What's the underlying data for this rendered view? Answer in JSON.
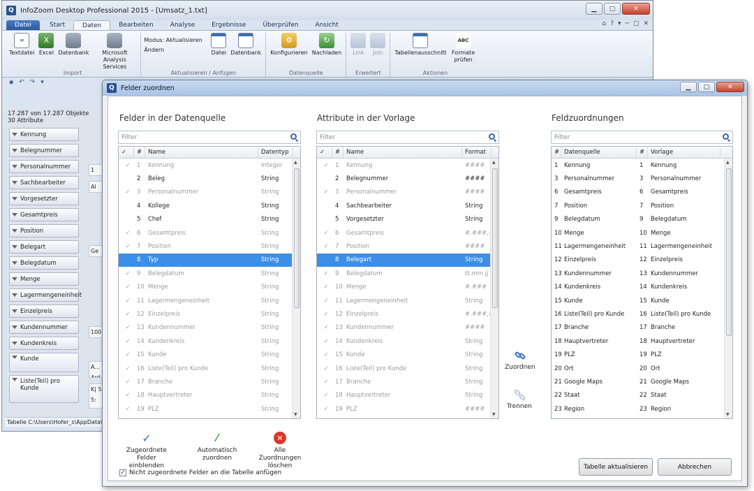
{
  "app": {
    "title": "InfoZoom Desktop Professional 2015 - [Umsatz_1.txt]",
    "win_min": "▁",
    "win_max": "▢",
    "win_close": "✕"
  },
  "ribbon": {
    "tabs": [
      "Datei",
      "Start",
      "Daten",
      "Bearbeiten",
      "Analyse",
      "Ergebnisse",
      "Überprüfen",
      "Ansicht"
    ],
    "right_icons": [
      "⌂",
      "?",
      "▾",
      "─",
      "▢",
      "✕"
    ],
    "groups": {
      "import": {
        "label": "Import",
        "buttons": [
          "Textdatei",
          "Excel",
          "Datenbank",
          "Microsoft Analysis Services"
        ]
      },
      "update": {
        "label": "Aktualisieren / Anfügen",
        "mode": "Modus: Aktualisieren",
        "change": "Ändern",
        "buttons": [
          "Datei",
          "Datenbank"
        ]
      },
      "source": {
        "label": "Datenquelle",
        "buttons": [
          "Konfigurieren",
          "Nachladen"
        ]
      },
      "extended": {
        "label": "Erweitert",
        "buttons": [
          "Link",
          "Join"
        ]
      },
      "actions": {
        "label": "Aktionen",
        "buttons": [
          "Tabellenausschnitt",
          "Formate prüfen"
        ]
      }
    }
  },
  "left": {
    "objects": "17.287 von 17.287 Objekte",
    "attributes": "30 Attribute",
    "attr_buttons": [
      "Kennung",
      "Belegnummer",
      "Personalnummer",
      "Sachbearbeiter",
      "Vorgesetzter",
      "Gesamtpreis",
      "Position",
      "Belegart",
      "Belegdatum",
      "Menge",
      "Lagermengeneinheit",
      "Einzelpreis",
      "Kundennummer",
      "Kundenkreis",
      "Kunde",
      "Liste(Teil) pro Kunde"
    ],
    "values": [
      "1",
      "Al",
      "Ge",
      "100",
      "A... Ard",
      "K| 5: 5:"
    ],
    "status": "Tabelle  C:\\Users\\Hofer_s\\AppData\\L"
  },
  "dialog": {
    "title": "Felder zuordnen",
    "source": {
      "title": "Felder in der Datenquelle",
      "filter_placeholder": "Filter",
      "headers": [
        "#",
        "Name",
        "Datentyp"
      ],
      "rows": [
        {
          "n": "1",
          "name": "Kennung",
          "type": "Integer",
          "mapped": true
        },
        {
          "n": "2",
          "name": "Beleg",
          "type": "String",
          "mapped": false
        },
        {
          "n": "3",
          "name": "Personalnummer",
          "type": "String",
          "mapped": true
        },
        {
          "n": "4",
          "name": "Kollege",
          "type": "String",
          "mapped": false
        },
        {
          "n": "5",
          "name": "Chef",
          "type": "String",
          "mapped": false
        },
        {
          "n": "6",
          "name": "Gesamtpreis",
          "type": "String",
          "mapped": true
        },
        {
          "n": "7",
          "name": "Position",
          "type": "String",
          "mapped": true
        },
        {
          "n": "8",
          "name": "Typ",
          "type": "String",
          "mapped": false,
          "selected": true
        },
        {
          "n": "9",
          "name": "Belegdatum",
          "type": "String",
          "mapped": true
        },
        {
          "n": "10",
          "name": "Menge",
          "type": "String",
          "mapped": true
        },
        {
          "n": "11",
          "name": "Lagermengeneinheit",
          "type": "String",
          "mapped": true
        },
        {
          "n": "12",
          "name": "Einzelpreis",
          "type": "String",
          "mapped": true
        },
        {
          "n": "13",
          "name": "Kundennummer",
          "type": "String",
          "mapped": true
        },
        {
          "n": "14",
          "name": "Kundenkreis",
          "type": "String",
          "mapped": true
        },
        {
          "n": "15",
          "name": "Kunde",
          "type": "String",
          "mapped": true
        },
        {
          "n": "16",
          "name": "Liste(Teil) pro Kunde",
          "type": "String",
          "mapped": true
        },
        {
          "n": "17",
          "name": "Branche",
          "type": "String",
          "mapped": true
        },
        {
          "n": "18",
          "name": "Hauptvertreter",
          "type": "String",
          "mapped": true
        },
        {
          "n": "19",
          "name": "PLZ",
          "type": "String",
          "mapped": true
        }
      ]
    },
    "template": {
      "title": "Attribute in der Vorlage",
      "filter_placeholder": "Filter",
      "headers": [
        "#",
        "Name",
        "Format"
      ],
      "rows": [
        {
          "n": "1",
          "name": "Kennung",
          "fmt": "####",
          "mapped": true
        },
        {
          "n": "2",
          "name": "Belegnummer",
          "fmt": "####",
          "mapped": false
        },
        {
          "n": "3",
          "name": "Personalnummer",
          "fmt": "####",
          "mapped": true
        },
        {
          "n": "4",
          "name": "Sachbearbeiter",
          "fmt": "String",
          "mapped": false
        },
        {
          "n": "5",
          "name": "Vorgesetzter",
          "fmt": "String",
          "mapped": false
        },
        {
          "n": "6",
          "name": "Gesamtpreis",
          "fmt": "#.###,##",
          "mapped": true
        },
        {
          "n": "7",
          "name": "Position",
          "fmt": "####",
          "mapped": true
        },
        {
          "n": "8",
          "name": "Belegart",
          "fmt": "String",
          "mapped": false,
          "selected": true
        },
        {
          "n": "9",
          "name": "Belegdatum",
          "fmt": "tt.mm.jj",
          "mapped": true
        },
        {
          "n": "10",
          "name": "Menge",
          "fmt": "#.###",
          "mapped": true
        },
        {
          "n": "11",
          "name": "Lagermengeneinheit",
          "fmt": "String",
          "mapped": true
        },
        {
          "n": "12",
          "name": "Einzelpreis",
          "fmt": "#.###,##",
          "mapped": true
        },
        {
          "n": "13",
          "name": "Kundennummer",
          "fmt": "####",
          "mapped": true
        },
        {
          "n": "14",
          "name": "Kundenkreis",
          "fmt": "String",
          "mapped": true
        },
        {
          "n": "15",
          "name": "Kunde",
          "fmt": "String",
          "mapped": true
        },
        {
          "n": "16",
          "name": "Liste(Teil) pro Kunde",
          "fmt": "String",
          "mapped": true
        },
        {
          "n": "17",
          "name": "Branche",
          "fmt": "String",
          "mapped": true
        },
        {
          "n": "18",
          "name": "Hauptvertreter",
          "fmt": "String",
          "mapped": true
        },
        {
          "n": "19",
          "name": "PLZ",
          "fmt": "####",
          "mapped": true
        }
      ]
    },
    "mapping": {
      "title": "Feldzuordnungen",
      "filter_placeholder": "Filter",
      "headers": [
        "#",
        "Datenquelle",
        "#",
        "Vorlage"
      ],
      "rows": [
        [
          "1",
          "Kennung",
          "1",
          "Kennung"
        ],
        [
          "3",
          "Personalnummer",
          "3",
          "Personalnummer"
        ],
        [
          "6",
          "Gesamtpreis",
          "6",
          "Gesamtpreis"
        ],
        [
          "7",
          "Position",
          "7",
          "Position"
        ],
        [
          "9",
          "Belegdatum",
          "9",
          "Belegdatum"
        ],
        [
          "10",
          "Menge",
          "10",
          "Menge"
        ],
        [
          "11",
          "Lagermengeneinheit",
          "11",
          "Lagermengeneinheit"
        ],
        [
          "12",
          "Einzelpreis",
          "12",
          "Einzelpreis"
        ],
        [
          "13",
          "Kundennummer",
          "13",
          "Kundennummer"
        ],
        [
          "14",
          "Kundenkreis",
          "14",
          "Kundenkreis"
        ],
        [
          "15",
          "Kunde",
          "15",
          "Kunde"
        ],
        [
          "16",
          "Liste(Teil) pro Kunde",
          "16",
          "Liste(Teil) pro Kunde"
        ],
        [
          "17",
          "Branche",
          "17",
          "Branche"
        ],
        [
          "18",
          "Hauptvertreter",
          "18",
          "Hauptvertreter"
        ],
        [
          "19",
          "PLZ",
          "19",
          "PLZ"
        ],
        [
          "20",
          "Ort",
          "20",
          "Ort"
        ],
        [
          "21",
          "Google Maps",
          "21",
          "Google Maps"
        ],
        [
          "22",
          "Staat",
          "22",
          "Staat"
        ],
        [
          "23",
          "Region",
          "23",
          "Region"
        ]
      ]
    },
    "assign_label": "Zuordnen",
    "separate_label": "Trennen",
    "show_mapped": "Zugeordnete Felder einblenden",
    "auto_assign": "Automatisch zuordnen",
    "delete_all": "Alle Zuordnungen löschen",
    "append_checkbox": "Nicht zugeordnete Felder an die Tabelle anfügen",
    "append_checked": true,
    "update_button": "Tabelle aktualisieren",
    "cancel_button": "Abbrechen"
  },
  "colors": {
    "selection": "#3d8ee6",
    "accent": "#2a5aa0",
    "delete": "#d9352b"
  }
}
